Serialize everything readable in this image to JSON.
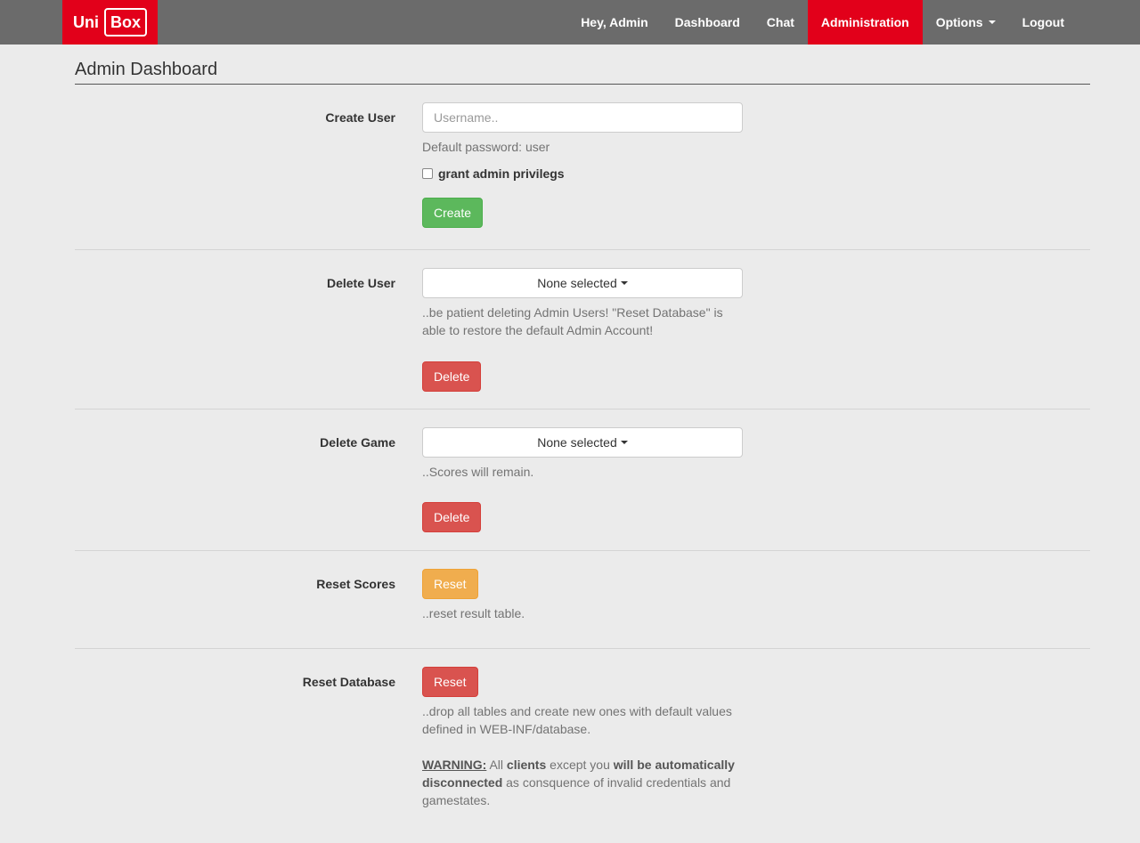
{
  "navbar": {
    "brand_left": "Uni",
    "brand_right": "Box",
    "items": [
      {
        "label": "Hey, Admin"
      },
      {
        "label": "Dashboard"
      },
      {
        "label": "Chat"
      },
      {
        "label": "Administration",
        "active": true
      },
      {
        "label": "Options",
        "dropdown": true
      },
      {
        "label": "Logout"
      }
    ]
  },
  "colors": {
    "navbar_bg": "#6b6b6b",
    "accent": "#e2001a",
    "page_bg": "#ebebeb",
    "success": "#5cb85c",
    "danger": "#d9534f",
    "warning": "#f0ad4e"
  },
  "page": {
    "title": "Admin Dashboard"
  },
  "create_user": {
    "label": "Create User",
    "placeholder": "Username..",
    "help": "Default password: user",
    "checkbox_label": "grant admin privilegs",
    "button": "Create"
  },
  "delete_user": {
    "label": "Delete User",
    "select_value": "None selected",
    "help": "..be patient deleting Admin Users! \"Reset Database\" is able to restore the default Admin Account!",
    "button": "Delete"
  },
  "delete_game": {
    "label": "Delete Game",
    "select_value": "None selected",
    "help": "..Scores will remain.",
    "button": "Delete"
  },
  "reset_scores": {
    "label": "Reset Scores",
    "button": "Reset",
    "help": "..reset result table."
  },
  "reset_database": {
    "label": "Reset Database",
    "button": "Reset",
    "help": "..drop all tables and create new ones with default values defined in WEB-INF/database.",
    "warning": {
      "prefix": "WARNING:",
      "t1": " All ",
      "b1": "clients",
      "t2": " except you ",
      "b2": "will be automatically disconnected",
      "t3": " as consquence of invalid credentials and gamestates."
    }
  }
}
